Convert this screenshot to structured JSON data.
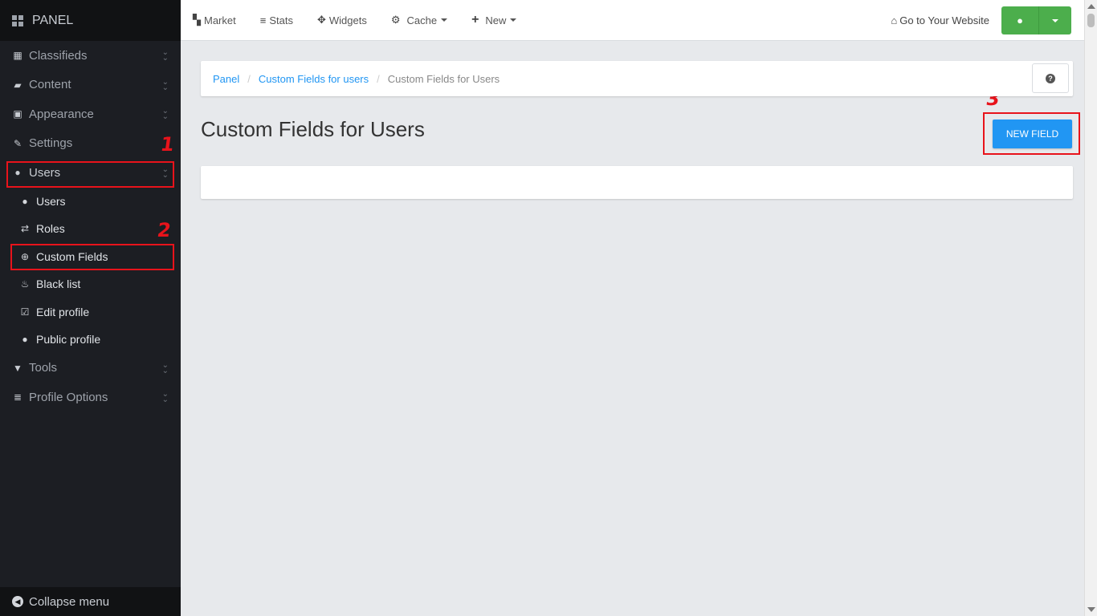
{
  "brand": {
    "title": "PANEL"
  },
  "sidebar": {
    "items": [
      {
        "label": "Classifieds",
        "icon": "th-icon"
      },
      {
        "label": "Content",
        "icon": "folder-open-icon"
      },
      {
        "label": "Appearance",
        "icon": "picture-icon"
      },
      {
        "label": "Settings",
        "icon": "wrench-icon"
      },
      {
        "label": "Users",
        "icon": "user-icon"
      }
    ],
    "users_sub": [
      {
        "label": "Users",
        "icon": "user-icon"
      },
      {
        "label": "Roles",
        "icon": "retweet-icon"
      },
      {
        "label": "Custom Fields",
        "icon": "plus-sign-icon"
      },
      {
        "label": "Black list",
        "icon": "fire-icon"
      },
      {
        "label": "Edit profile",
        "icon": "edit-icon"
      },
      {
        "label": "Public profile",
        "icon": "user-icon"
      }
    ],
    "after": [
      {
        "label": "Tools",
        "icon": "filter-icon"
      },
      {
        "label": "Profile Options",
        "icon": "list-icon"
      }
    ],
    "collapse_label": "Collapse menu"
  },
  "annotations": {
    "one": "1",
    "two": "2",
    "three": "3"
  },
  "topbar": {
    "market": "Market",
    "stats": "Stats",
    "widgets": "Widgets",
    "cache": "Cache",
    "new": "New",
    "goto": "Go to Your Website"
  },
  "breadcrumb": {
    "panel": "Panel",
    "custom_fields_users": "Custom Fields for users",
    "current": "Custom Fields for Users"
  },
  "main": {
    "title": "Custom Fields for Users",
    "new_field_label": "NEW FIELD"
  },
  "colors": {
    "accent": "#2196f3",
    "success": "#4cae4c",
    "annotation": "#e8131b",
    "sidebar_bg": "#1c1e23"
  }
}
